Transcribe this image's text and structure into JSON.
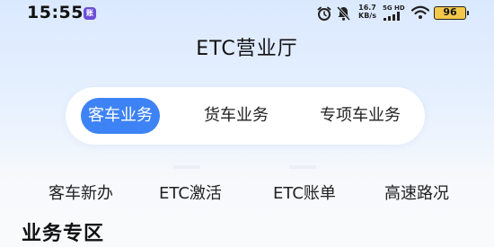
{
  "status_bar": {
    "time": "15:55",
    "app_badge": "账",
    "net_speed_value": "16.7",
    "net_speed_unit": "KB/s",
    "signal_label": "5G HD",
    "battery": "96"
  },
  "header": {
    "title": "ETC营业厅"
  },
  "tabs": [
    {
      "label": "客车业务",
      "active": true
    },
    {
      "label": "货车业务",
      "active": false
    },
    {
      "label": "专项车业务",
      "active": false
    }
  ],
  "shortcuts": [
    {
      "label": "客车新办"
    },
    {
      "label": "ETC激活"
    },
    {
      "label": "ETC账单"
    },
    {
      "label": "高速路况"
    }
  ],
  "section": {
    "title": "业务专区"
  },
  "colors": {
    "accent": "#3e83f5",
    "battery": "#f3c84a"
  }
}
